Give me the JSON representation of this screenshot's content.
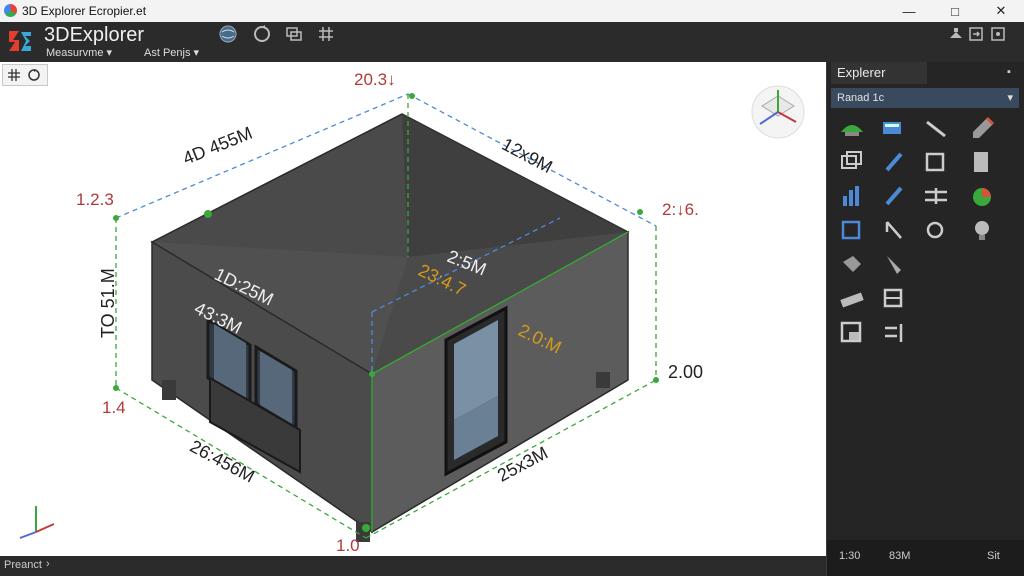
{
  "window": {
    "title": "3D Explorer Ecropier.et",
    "controls": {
      "minimize": "—",
      "maximize": "□",
      "close": "✕"
    }
  },
  "app": {
    "name": "3DExplorer",
    "menus": [
      {
        "label": "Measurvme"
      },
      {
        "label": "Ast Penjs"
      }
    ]
  },
  "dimensions": {
    "top": "20.3↓",
    "left_top": "1.2.3",
    "right_top": "2:↓6.",
    "left_bottom": "1.4",
    "bottom": "1.0",
    "right": "2.00",
    "edge_back_left": "4D 455M",
    "edge_back_right": "12x9M",
    "edge_front_left": "26:456M",
    "edge_front_right": "25x3M",
    "height": "TO 51.M",
    "inner_1": "1D:25M",
    "inner_2": "43:3M",
    "inner_3": "2:5M",
    "inner_orange_1": "23:4.7",
    "inner_orange_2": "2.0:M"
  },
  "status": {
    "text": "Preanct"
  },
  "panel": {
    "tab": "Explerer",
    "dropdown": "Ranad 1c",
    "footer": [
      "1:30",
      "83M",
      "Sit"
    ]
  },
  "colors": {
    "accent": "#4d8ad6",
    "dim_red": "#b03a3a",
    "dim_orange": "#d49a1a",
    "guide_green": "#3aa83a"
  }
}
